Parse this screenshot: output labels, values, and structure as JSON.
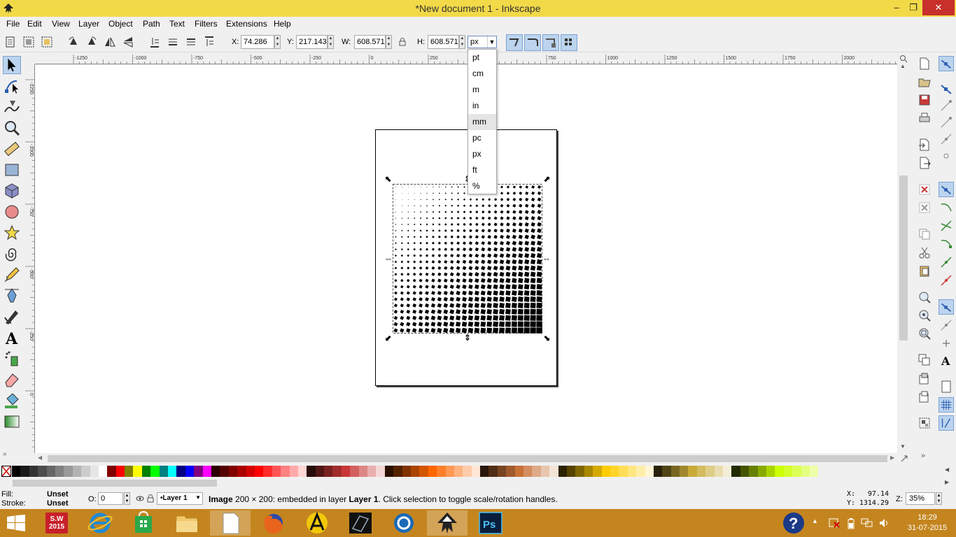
{
  "window": {
    "title": "*New document 1 - Inkscape",
    "minimize": "–",
    "maximize": "❐",
    "close": "✕"
  },
  "menu": [
    "File",
    "Edit",
    "View",
    "Layer",
    "Object",
    "Path",
    "Text",
    "Filters",
    "Extensions",
    "Help"
  ],
  "toolcontrols": {
    "x_label": "X:",
    "x_value": "74.286",
    "y_label": "Y:",
    "y_value": "217.143",
    "w_label": "W:",
    "w_value": "608.571",
    "h_label": "H:",
    "h_value": "608.571",
    "unit": "px"
  },
  "unit_dropdown": {
    "options": [
      "pt",
      "cm",
      "m",
      "in",
      "mm",
      "pc",
      "px",
      "ft",
      "%"
    ],
    "hovered": "mm"
  },
  "ruler_top": [
    "-1250",
    "-1000",
    "-750",
    "-500",
    "-250",
    "0",
    "250",
    "500",
    "750",
    "1000",
    "1250",
    "1500",
    "1750",
    "2000"
  ],
  "ruler_left": [
    "-1250",
    "-1000",
    "-750",
    "-500",
    "-250",
    "0"
  ],
  "status": {
    "fill_label": "Fill:",
    "fill_value": "Unset",
    "stroke_label": "Stroke:",
    "stroke_value": "Unset",
    "opacity_label": "O:",
    "opacity_value": "0",
    "layer": "•Layer 1",
    "message_bold": "Image",
    "message_middle": "200 × 200: embedded in layer",
    "message_layer": "Layer 1",
    "message_end": ". Click selection to toggle scale/rotation handles.",
    "cursor_x_label": "X:",
    "cursor_x": "97.14",
    "cursor_y_label": "Y:",
    "cursor_y": "1314.29",
    "zoom_label": "Z:",
    "zoom": "35%"
  },
  "taskbar": {
    "time": "18:29",
    "date": "31-07-2015",
    "solidworks_label": "S.W 2015"
  },
  "colors": {
    "titlebar": "#f2d948",
    "taskbar": "#c4851f",
    "selection": "#bcd4ee"
  }
}
